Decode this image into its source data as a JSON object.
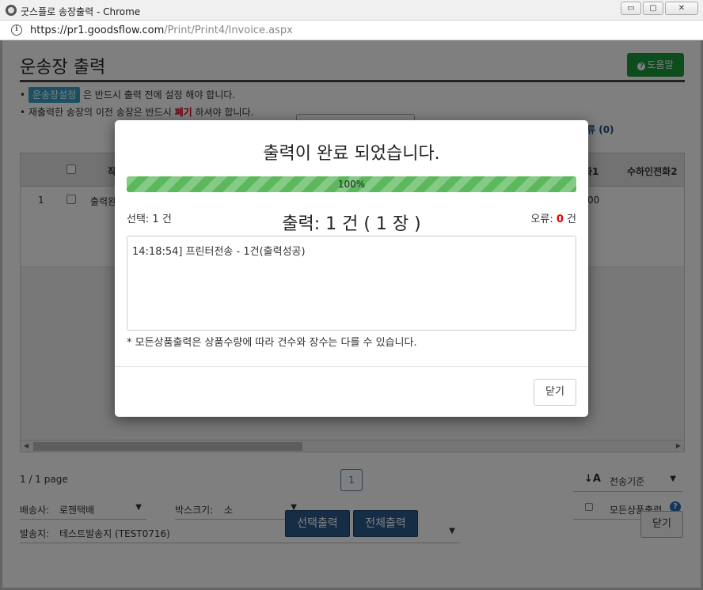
{
  "window": {
    "title": "굿스플로 송장출력 - Chrome",
    "url_host": "https://pr1.goodsflow.com",
    "url_path": "/Print/Print4/Invoice.aspx",
    "minimize": "▭",
    "maximize": "▢",
    "close": "✕"
  },
  "page": {
    "title": "운송장 출력",
    "help_label": "도움말",
    "help_q": "?",
    "note1_badge": "운송장설정",
    "note1_text": "은 반드시 출력 전에 설정 해야 합니다.",
    "note2_pre": "재출력한 송장의 이전 송장은 반드시 ",
    "note2_red": "폐기",
    "note2_post": " 하셔야 합니다.",
    "frag_right": "류 (0)"
  },
  "grid": {
    "columns": [
      "작",
      "화1",
      "수하인전화2"
    ],
    "row1": {
      "no": "1",
      "col_status": "출력완",
      "col_phone1": "00"
    }
  },
  "footer": {
    "page_info": "1 / 1 page",
    "page_number": "1",
    "sort_icon": "↓A",
    "sort_label": "전송기준",
    "all_items_label": "모든상품출력",
    "all_items_q": "?",
    "carrier_label": "배송사:",
    "carrier_value": "로젠택배",
    "box_label": "박스크기:",
    "box_value": "소",
    "origin_label": "발송지:",
    "origin_value": "테스트발송지 (TEST0716)",
    "btn_print_selected": "선택출력",
    "btn_print_all": "전체출력",
    "btn_close": "닫기",
    "caret": "▼"
  },
  "modal": {
    "title": "출력이 완료 되었습니다.",
    "progress_text": "100%",
    "progress_value": 100,
    "selected_count": "선택: 1 건",
    "print_count": "출력: 1 건 ( 1 장 )",
    "error_label": "오류: ",
    "error_value": "0",
    "error_unit": " 건",
    "log_line": "14:18:54] 프린터전송 - 1건(출력성공)",
    "note": "* 모든상품출력은 상품수량에 따라 건수와 장수는 다를 수 있습니다.",
    "close_label": "닫기"
  }
}
